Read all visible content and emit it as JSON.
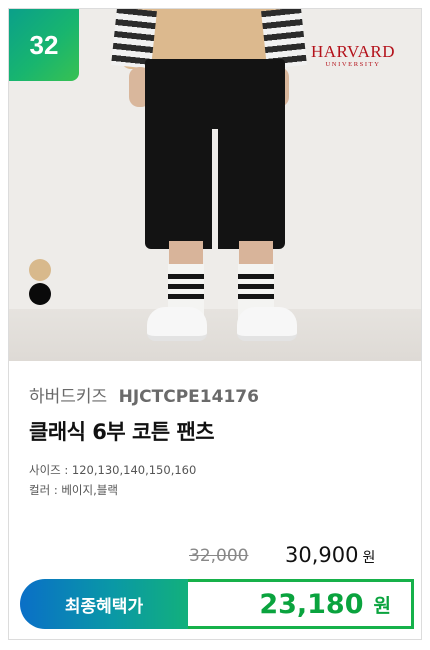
{
  "badge": {
    "number": "32"
  },
  "logo": {
    "main": "HARVARD",
    "sub": "UNIVERSITY"
  },
  "colors": {
    "chips": [
      "#d8b98c",
      "#0a0a0a"
    ],
    "accent_green": "#0aa33e",
    "badge_gradient": [
      "#0aa08a",
      "#38c152"
    ],
    "label_gradient": [
      "#0a6fc7",
      "#12b07c"
    ]
  },
  "product": {
    "brand": "하버드키즈",
    "code": "HJCTCPE14176",
    "name": "클래식 6부 코튼 팬츠",
    "sizes": "사이즈 : 120,130,140,150,160",
    "colors": "컬러 : 베이지,블랙"
  },
  "price": {
    "original": "32,000",
    "current": "30,900",
    "current_unit": "원",
    "benefit_label": "최종혜택가",
    "benefit_amount": "23,180",
    "benefit_unit": "원"
  }
}
